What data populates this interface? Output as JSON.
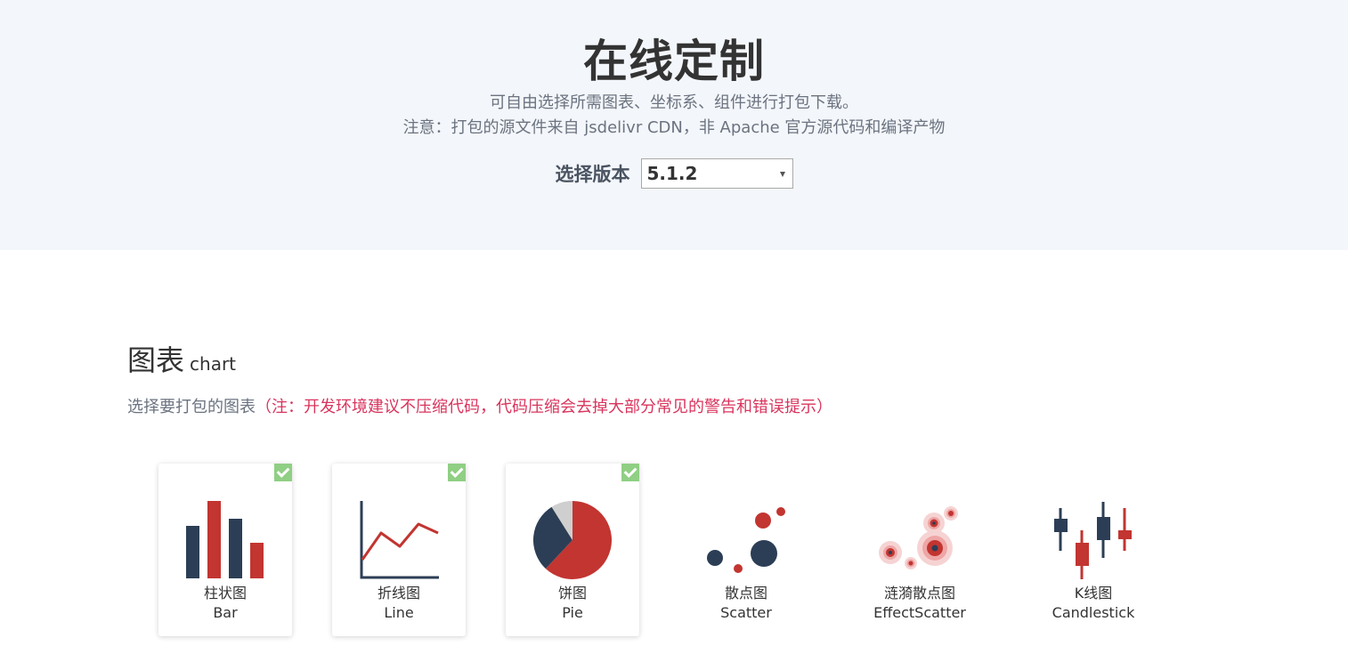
{
  "header": {
    "title": "在线定制",
    "subtitle_line1": "可自由选择所需图表、坐标系、组件进行打包下载。",
    "subtitle_line2": "注意：打包的源文件来自 jsdelivr CDN，非 Apache 官方源代码和编译产物",
    "version_label": "选择版本",
    "version_value": "5.1.2"
  },
  "section": {
    "title": "图表",
    "title_en": "chart",
    "desc": "选择要打包的图表",
    "note": "（注：开发环境建议不压缩代码，代码压缩会去掉大部分常见的警告和错误提示）"
  },
  "charts": [
    {
      "name": "柱状图",
      "name_en": "Bar",
      "checked": true,
      "icon": "bar-chart-icon"
    },
    {
      "name": "折线图",
      "name_en": "Line",
      "checked": true,
      "icon": "line-chart-icon"
    },
    {
      "name": "饼图",
      "name_en": "Pie",
      "checked": true,
      "icon": "pie-chart-icon"
    },
    {
      "name": "散点图",
      "name_en": "Scatter",
      "checked": false,
      "icon": "scatter-chart-icon"
    },
    {
      "name": "涟漪散点图",
      "name_en": "EffectScatter",
      "checked": false,
      "icon": "effect-scatter-chart-icon"
    },
    {
      "name": "K线图",
      "name_en": "Candlestick",
      "checked": false,
      "icon": "candlestick-chart-icon"
    }
  ],
  "colors": {
    "dark": "#2c3e55",
    "red": "#c23531",
    "check": "#90cf84",
    "hero_bg": "#f3f6fa",
    "note": "#d9345d"
  }
}
